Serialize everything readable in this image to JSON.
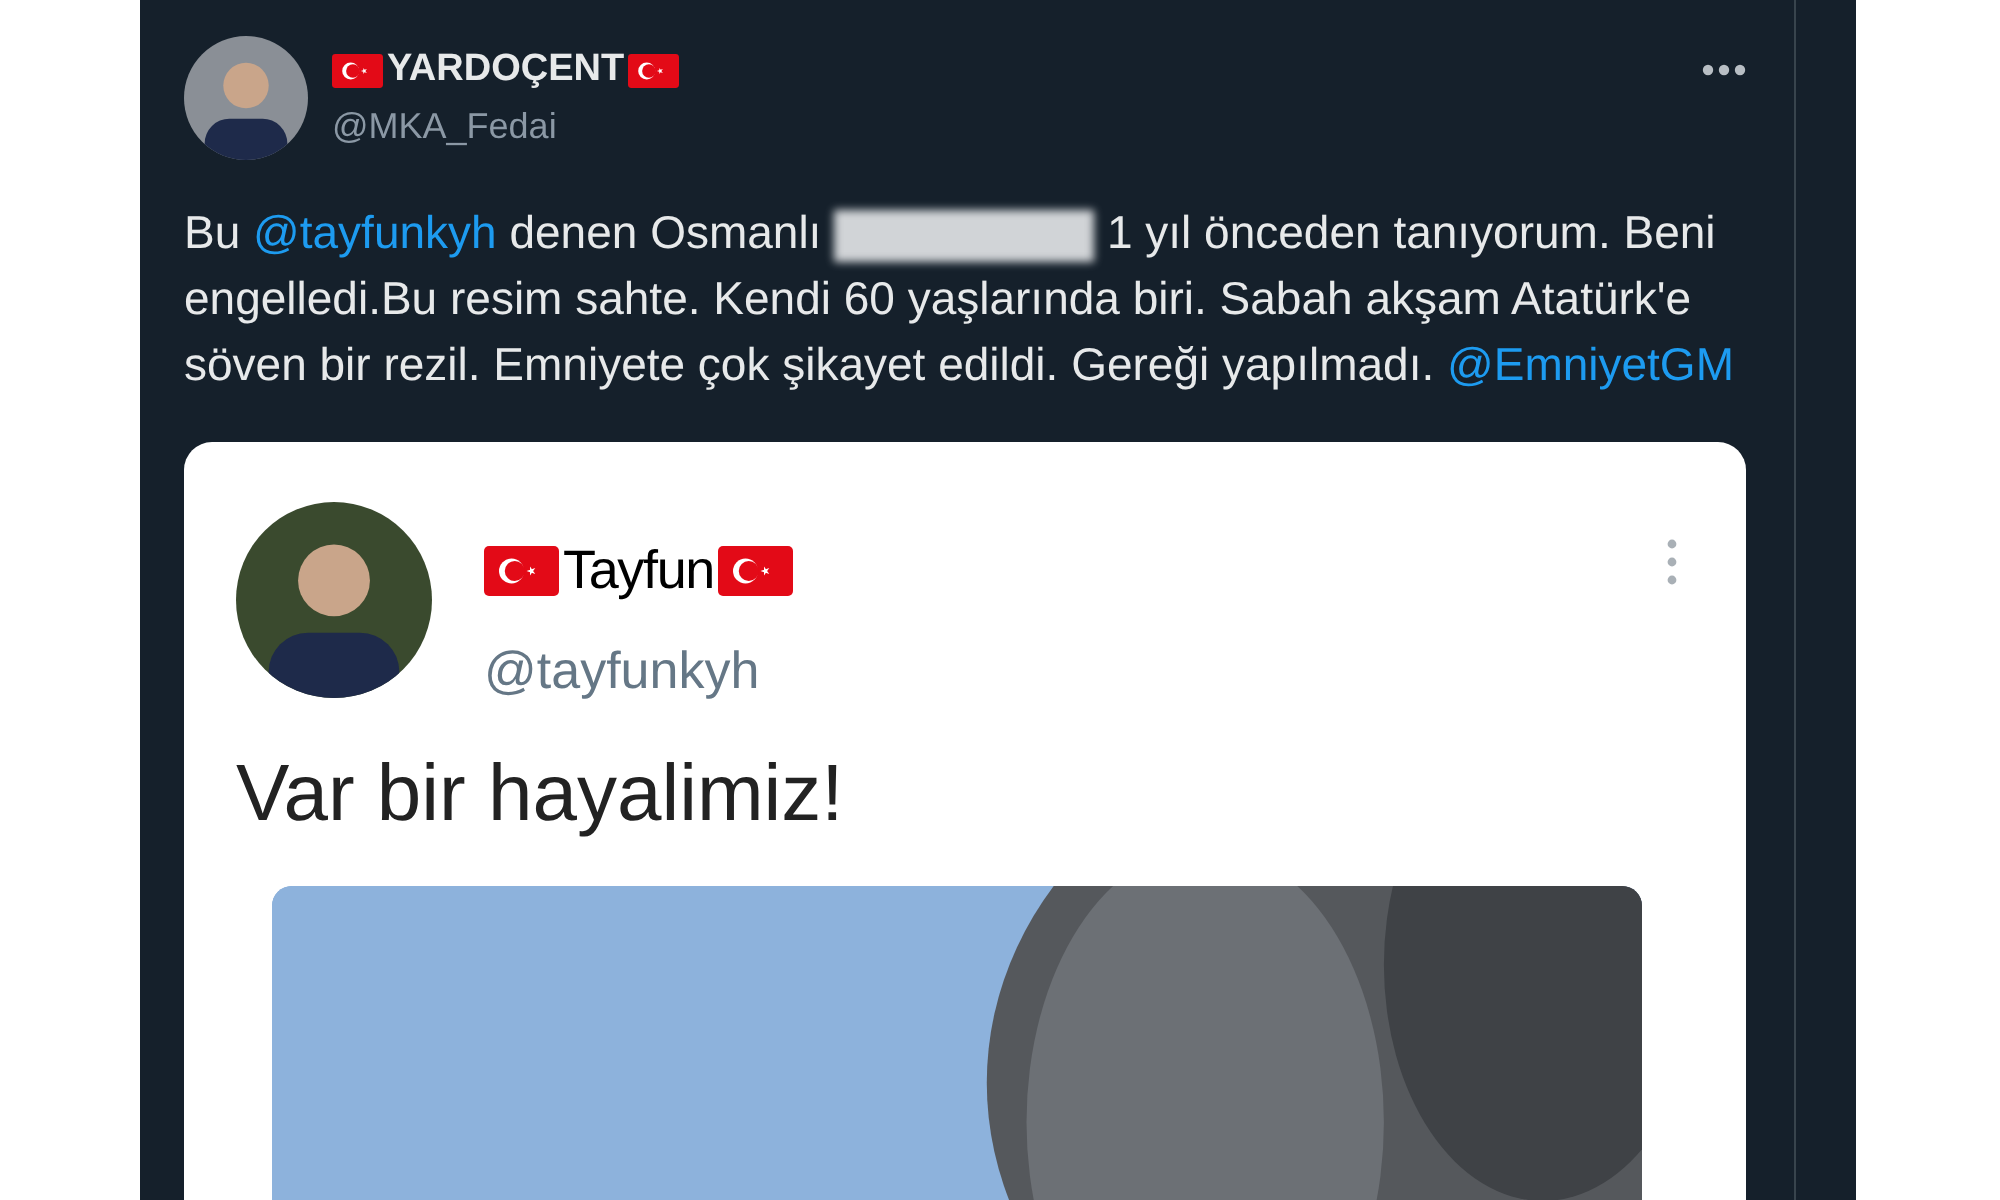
{
  "tweet": {
    "author": {
      "name": "YARDOÇENT",
      "handle": "@MKA_Fedai"
    },
    "body": [
      {
        "kind": "text",
        "text": "Bu "
      },
      {
        "kind": "mention",
        "text": "@tayfunkyh"
      },
      {
        "kind": "text",
        "text": " denen Osmanlı "
      },
      {
        "kind": "redacted"
      },
      {
        "kind": "text",
        "text": " 1 yıl önceden tanıyorum. Beni engelledi.Bu resim sahte. Kendi 60 yaşlarında biri. Sabah akşam Atatürk'e söven bir rezil. Emniyete çok şikayet edildi. Gereği yapılmadı. "
      },
      {
        "kind": "mention",
        "text": "@EmniyetGM"
      }
    ],
    "embedded_screenshot": {
      "author": {
        "name": "Tayfun",
        "handle": "@tayfunkyh"
      },
      "text": "Var bir hayalimiz!"
    }
  }
}
